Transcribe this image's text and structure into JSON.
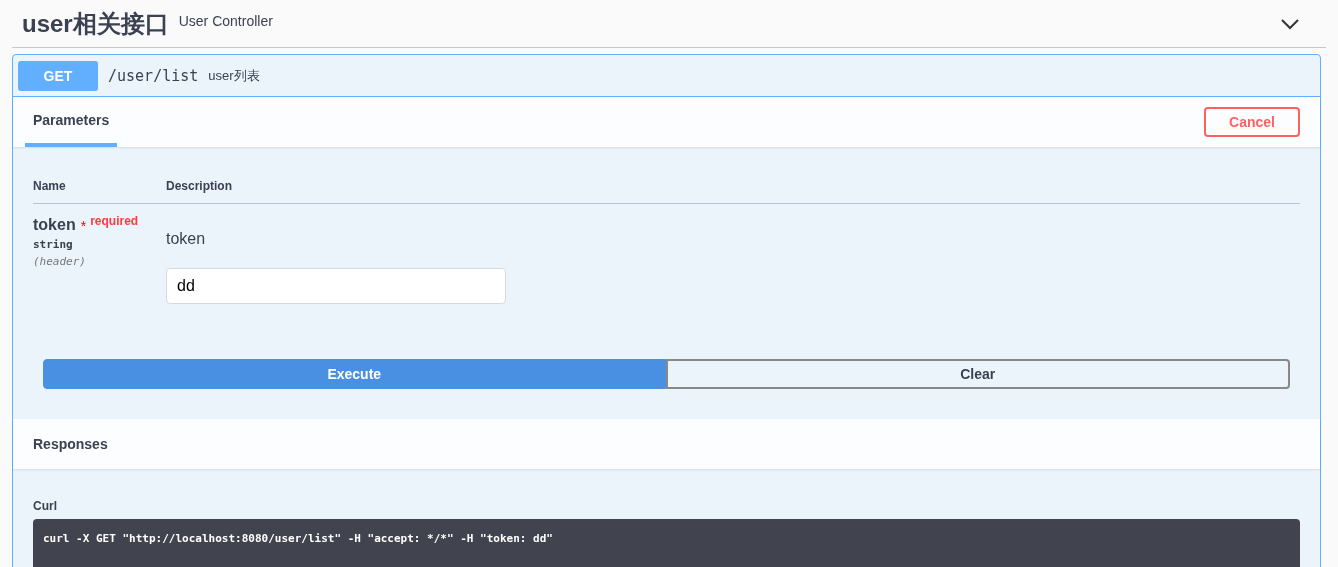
{
  "tag": {
    "name": "user相关接口",
    "description": "User Controller",
    "expanded": true
  },
  "operation": {
    "method": "GET",
    "path": "/user/list",
    "summary": "user列表"
  },
  "parameters_tab": {
    "label": "Parameters",
    "selected": true
  },
  "cancel_button": "Cancel",
  "table": {
    "columns": [
      "Name",
      "Description"
    ],
    "rows": [
      {
        "name": "token",
        "required_mark": "*",
        "required_label": "required",
        "type": "string",
        "location": "(header)",
        "description": "token",
        "value": "dd"
      }
    ]
  },
  "buttons": [
    {
      "label": "Execute",
      "kind": "primary"
    },
    {
      "label": "Clear",
      "kind": "secondary"
    }
  ],
  "responses": {
    "title": "Responses",
    "curl_label": "Curl",
    "curl": "curl -X GET \"http://localhost:8080/user/list\" -H \"accept: */*\" -H \"token: dd\""
  }
}
